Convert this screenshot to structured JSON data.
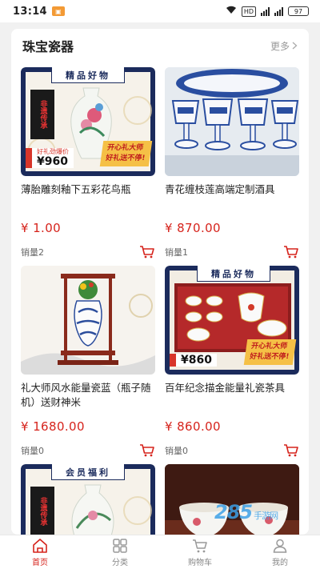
{
  "status_bar": {
    "time": "13:14",
    "battery": "97",
    "net_label": "HD"
  },
  "section": {
    "title": "珠宝瓷器",
    "more_label": "更多"
  },
  "products": [
    {
      "name": "薄胎雕刻釉下五彩花鸟瓶",
      "price": "¥ 1.00",
      "sales": "销量2",
      "poster": {
        "banner": "精品好物",
        "vertical": "非遗传承",
        "price_tag": "好礼劲爆价",
        "price": "¥960",
        "slogan_line1": "开心礼大师",
        "slogan_line2": "好礼送不停!"
      }
    },
    {
      "name": "青花缠枝莲高端定制酒具",
      "price": "¥ 870.00",
      "sales": "销量1"
    },
    {
      "name": "礼大师风水能量瓷蓝（瓶子随机）送财神米",
      "price": "¥ 1680.00",
      "sales": "销量0"
    },
    {
      "name": "百年纪念描金能量礼瓷茶具",
      "price": "¥ 860.00",
      "sales": "销量0",
      "poster": {
        "banner": "精品好物",
        "price": "¥860",
        "slogan_line1": "开心礼大师",
        "slogan_line2": "好礼送不停!"
      }
    },
    {
      "poster": {
        "banner": "会员福利",
        "vertical": "非遗传承"
      }
    },
    {}
  ],
  "nav": [
    {
      "label": "首页",
      "icon": "home-icon",
      "active": true
    },
    {
      "label": "分类",
      "icon": "category-icon",
      "active": false
    },
    {
      "label": "购物车",
      "icon": "cart-icon",
      "active": false
    },
    {
      "label": "我的",
      "icon": "user-icon",
      "active": false
    }
  ],
  "watermark": {
    "text": "285",
    "sub": "手游网"
  },
  "colors": {
    "accent": "#d6231c",
    "poster_navy": "#1b2b5c",
    "poster_gold": "#f5c046"
  }
}
